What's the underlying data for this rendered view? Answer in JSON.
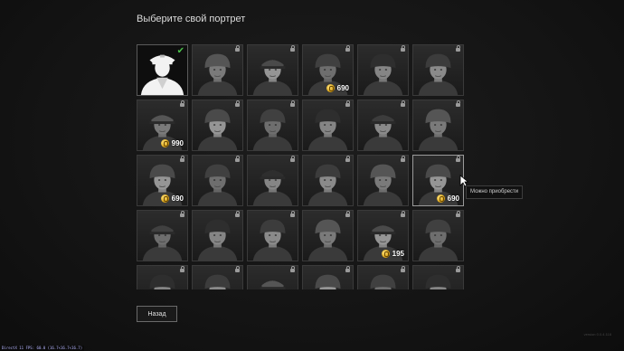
{
  "title": "Выберите свой портрет",
  "tooltip": "Можно приобрести",
  "back_label": "Назад",
  "version_text": "version 0.0.4.118",
  "debug_text": "DirectX 11 FPS: 60.0 (16.7<16.7<16.7)",
  "colors": {
    "check": "#4cc24c",
    "coin": "#d9a419",
    "tile_border": "#3a3a3a"
  },
  "portraits": [
    {
      "selected": true,
      "locked": false,
      "price": "",
      "hovered": false
    },
    {
      "selected": false,
      "locked": true,
      "price": "",
      "hovered": false
    },
    {
      "selected": false,
      "locked": true,
      "price": "",
      "hovered": false
    },
    {
      "selected": false,
      "locked": true,
      "price": "690",
      "hovered": false
    },
    {
      "selected": false,
      "locked": true,
      "price": "",
      "hovered": false
    },
    {
      "selected": false,
      "locked": true,
      "price": "",
      "hovered": false
    },
    {
      "selected": false,
      "locked": true,
      "price": "990",
      "hovered": false
    },
    {
      "selected": false,
      "locked": true,
      "price": "",
      "hovered": false
    },
    {
      "selected": false,
      "locked": true,
      "price": "",
      "hovered": false
    },
    {
      "selected": false,
      "locked": true,
      "price": "",
      "hovered": false
    },
    {
      "selected": false,
      "locked": true,
      "price": "",
      "hovered": false
    },
    {
      "selected": false,
      "locked": true,
      "price": "",
      "hovered": false
    },
    {
      "selected": false,
      "locked": true,
      "price": "690",
      "hovered": false
    },
    {
      "selected": false,
      "locked": true,
      "price": "",
      "hovered": false
    },
    {
      "selected": false,
      "locked": true,
      "price": "",
      "hovered": false
    },
    {
      "selected": false,
      "locked": true,
      "price": "",
      "hovered": false
    },
    {
      "selected": false,
      "locked": true,
      "price": "",
      "hovered": false
    },
    {
      "selected": false,
      "locked": true,
      "price": "690",
      "hovered": true
    },
    {
      "selected": false,
      "locked": true,
      "price": "",
      "hovered": false
    },
    {
      "selected": false,
      "locked": true,
      "price": "",
      "hovered": false
    },
    {
      "selected": false,
      "locked": true,
      "price": "",
      "hovered": false
    },
    {
      "selected": false,
      "locked": true,
      "price": "",
      "hovered": false
    },
    {
      "selected": false,
      "locked": true,
      "price": "195",
      "hovered": false
    },
    {
      "selected": false,
      "locked": true,
      "price": "",
      "hovered": false
    },
    {
      "selected": false,
      "locked": true,
      "price": "",
      "hovered": false
    },
    {
      "selected": false,
      "locked": true,
      "price": "",
      "hovered": false
    },
    {
      "selected": false,
      "locked": true,
      "price": "",
      "hovered": false
    },
    {
      "selected": false,
      "locked": true,
      "price": "",
      "hovered": false
    },
    {
      "selected": false,
      "locked": true,
      "price": "",
      "hovered": false
    },
    {
      "selected": false,
      "locked": true,
      "price": "",
      "hovered": false
    }
  ]
}
